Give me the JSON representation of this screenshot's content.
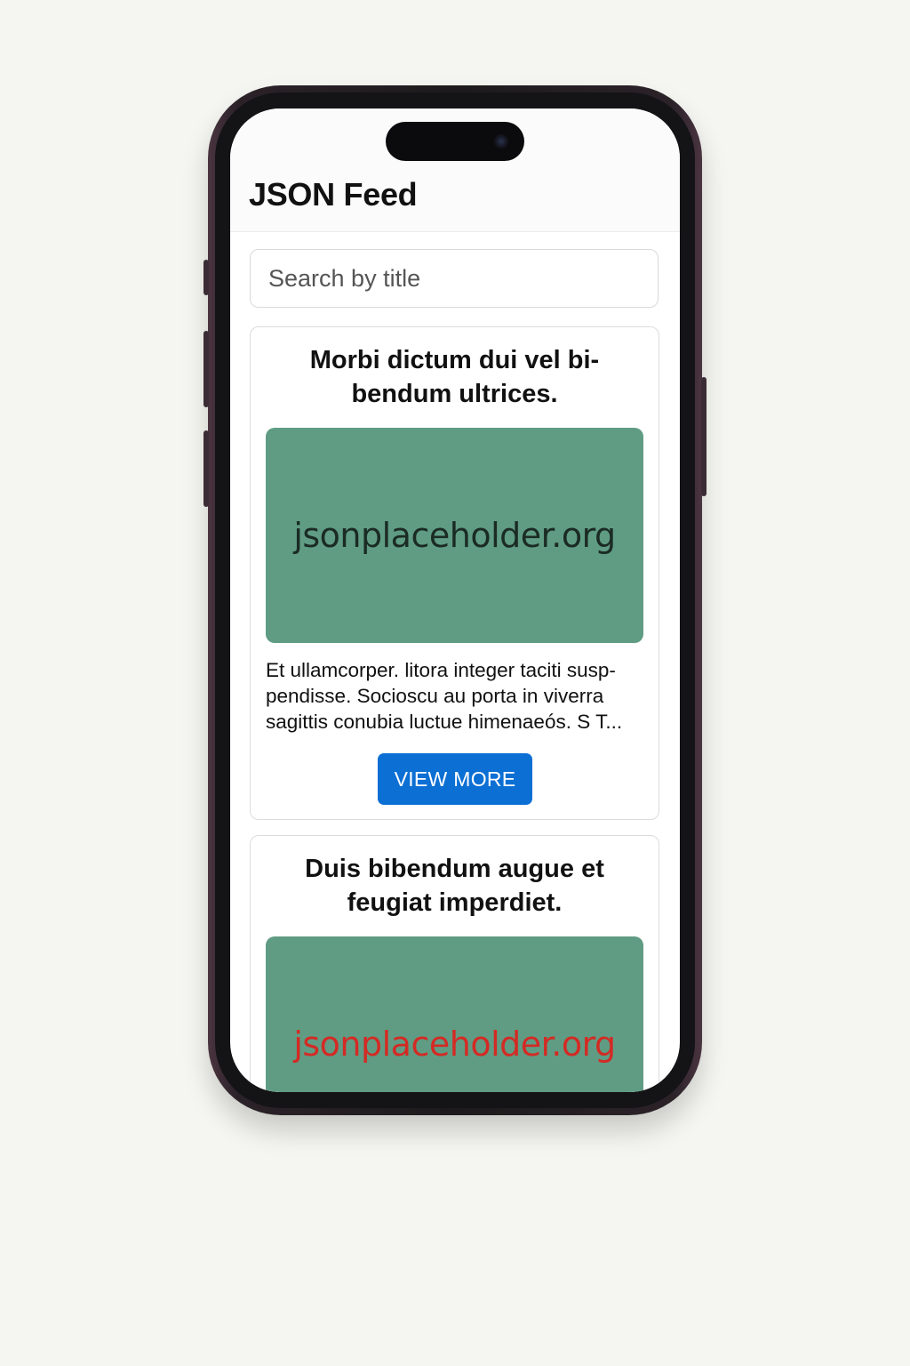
{
  "app": {
    "title": "JSON Feed"
  },
  "search": {
    "placeholder": "Search by title"
  },
  "colors": {
    "accent": "#0b6fd4",
    "image_bg": "#5f9c83",
    "image_text_dark": "#1b2b24",
    "image_text_red": "#d42a24"
  },
  "posts": [
    {
      "title": "Morbi dictum dui vel bi-bendum ultrices.",
      "image_text": "jsonplaceholder.org",
      "body": "Et ullamcorper. litora integer taciti susp-pendisse. Socioscu au porta in viverra sagittis conubia luctue himenaeós. S T...",
      "button_label": "VIEW MORE"
    },
    {
      "title": "Duis bibendum augue et feugiat imperdiet.",
      "image_text": "jsonplaceholder.org"
    }
  ]
}
